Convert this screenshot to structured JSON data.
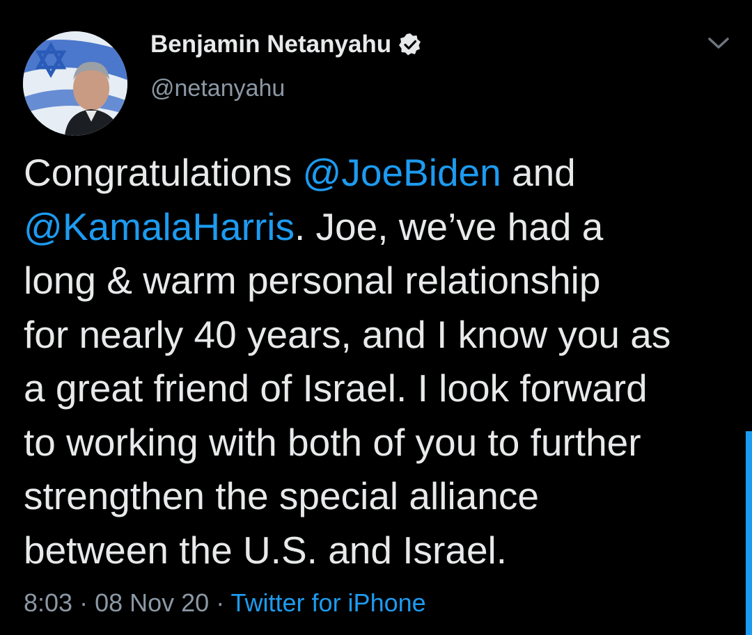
{
  "user": {
    "display_name": "Benjamin Netanyahu",
    "handle": "@netanyahu",
    "verified": true
  },
  "tweet": {
    "parts": [
      "Congratulations ",
      "@JoeBiden",
      " and\n",
      "@KamalaHarris",
      ". Joe, we’ve had a\nlong & warm personal relationship\nfor nearly 40 years, and I know you as\na great friend of Israel. I look forward\nto working with both of you to further\nstrengthen the special alliance\nbetween the U.S. and Israel."
    ]
  },
  "meta": {
    "time": "8:03",
    "date": "08 Nov 20",
    "separator": " · ",
    "source": "Twitter for iPhone"
  },
  "icons": {
    "verified": "verified-badge-icon",
    "menu": "chevron-down-icon"
  },
  "colors": {
    "background": "#000000",
    "text": "#e7e9ea",
    "secondary": "#8b98a5",
    "accent": "#1d9bf0"
  }
}
